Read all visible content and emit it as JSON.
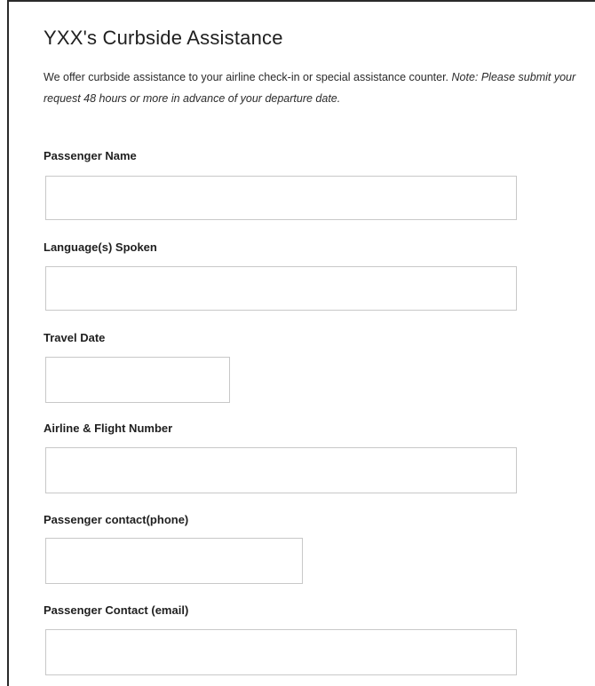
{
  "form": {
    "title": "YXX's Curbside Assistance",
    "intro_text": "We offer curbside assistance to your airline check-in or special assistance counter. ",
    "intro_note": "Note: Please submit your request 48 hours or more in advance of your departure date.",
    "fields": [
      {
        "label": "Passenger Name",
        "value": ""
      },
      {
        "label": "Language(s) Spoken",
        "value": ""
      },
      {
        "label": "Travel Date",
        "value": ""
      },
      {
        "label": "Airline & Flight Number",
        "value": ""
      },
      {
        "label": "Passenger contact(phone)",
        "value": ""
      },
      {
        "label": "Passenger Contact (email)",
        "value": ""
      }
    ]
  }
}
